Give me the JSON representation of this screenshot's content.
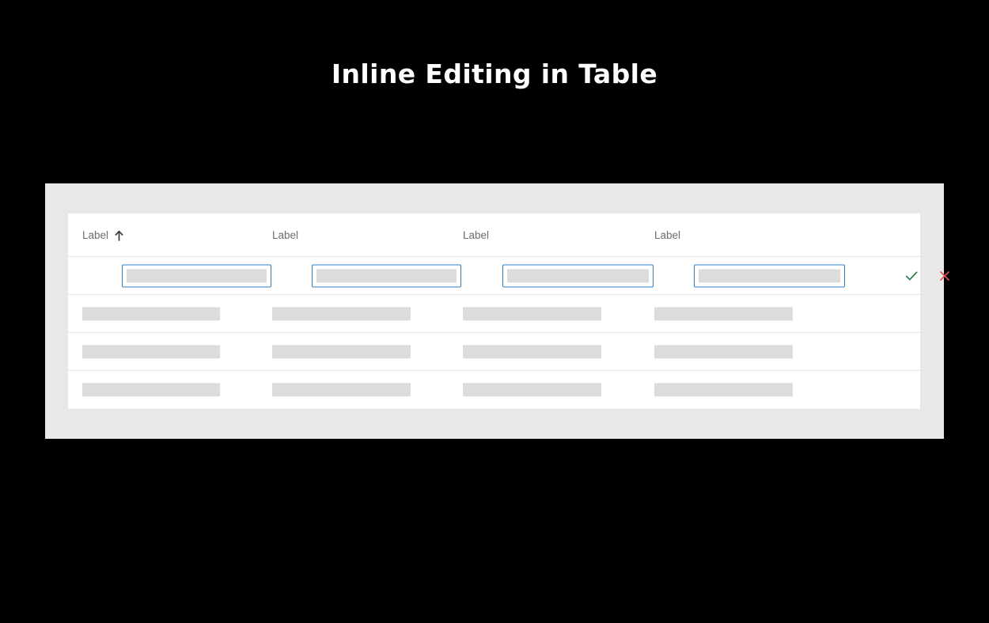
{
  "page": {
    "title": "Inline Editing in Table",
    "background_color": "#000000",
    "panel_color": "#e8e8e8",
    "card_color": "#ffffff"
  },
  "table": {
    "columns": [
      {
        "label": "Label",
        "sorted": true,
        "sort_icon": "arrow-up-icon",
        "sort_direction": "ascending"
      },
      {
        "label": "Label",
        "sorted": false,
        "sort_icon": "",
        "sort_direction": ""
      },
      {
        "label": "Label",
        "sorted": false,
        "sort_icon": "",
        "sort_direction": ""
      },
      {
        "label": "Label",
        "sorted": false,
        "sort_icon": "",
        "sort_direction": ""
      }
    ],
    "editing_row": {
      "state": "editing",
      "cells": [
        {
          "value": "",
          "placeholder": ""
        },
        {
          "value": "",
          "placeholder": ""
        },
        {
          "value": "",
          "placeholder": ""
        },
        {
          "value": "",
          "placeholder": ""
        }
      ],
      "actions": [
        {
          "name": "confirm-edit-button",
          "icon": "check-icon",
          "color": "#2e7d4f"
        },
        {
          "name": "cancel-edit-button",
          "icon": "close-icon",
          "color": "#e05252"
        }
      ]
    },
    "rows": [
      {
        "state": "read-only",
        "cells": [
          "",
          "",
          "",
          ""
        ]
      },
      {
        "state": "read-only",
        "cells": [
          "",
          "",
          "",
          ""
        ]
      },
      {
        "state": "read-only",
        "cells": [
          "",
          "",
          "",
          ""
        ]
      }
    ]
  },
  "colors": {
    "input_border": "#2f7cc9",
    "placeholder_bar": "#dcdcdc",
    "divider": "#e3e3e3",
    "header_text": "#6c6c6c",
    "confirm_green": "#2e7d4f",
    "cancel_red": "#e05252"
  }
}
